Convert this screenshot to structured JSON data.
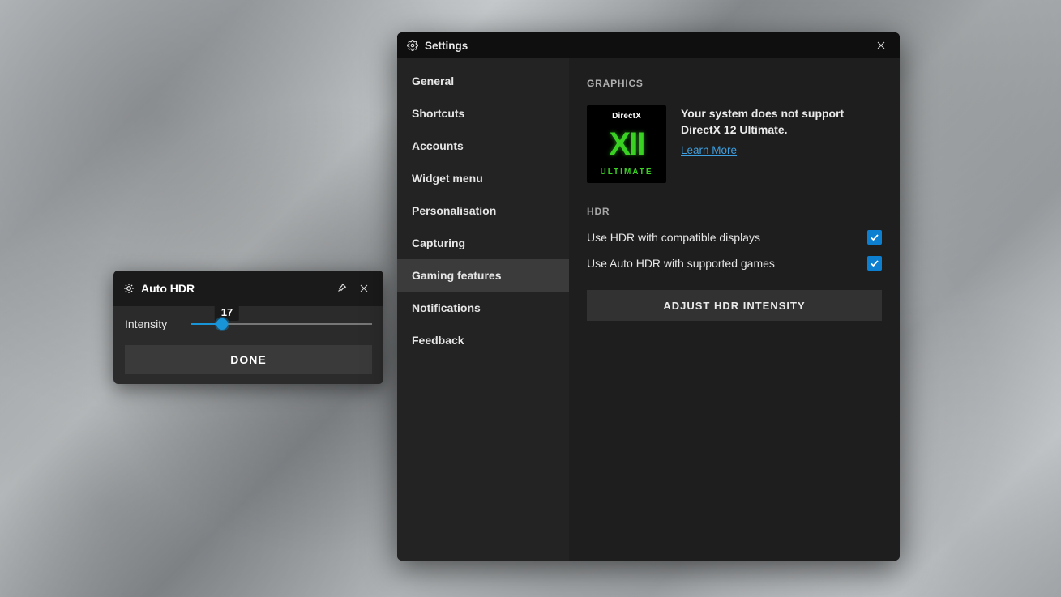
{
  "hdr_panel": {
    "title": "Auto HDR",
    "intensity_label": "Intensity",
    "intensity_value": "17",
    "intensity_percent": 17,
    "done_label": "DONE"
  },
  "settings": {
    "window_title": "Settings",
    "sidebar": {
      "items": [
        {
          "label": "General",
          "selected": false
        },
        {
          "label": "Shortcuts",
          "selected": false
        },
        {
          "label": "Accounts",
          "selected": false
        },
        {
          "label": "Widget menu",
          "selected": false
        },
        {
          "label": "Personalisation",
          "selected": false
        },
        {
          "label": "Capturing",
          "selected": false
        },
        {
          "label": "Gaming features",
          "selected": true
        },
        {
          "label": "Notifications",
          "selected": false
        },
        {
          "label": "Feedback",
          "selected": false
        }
      ]
    },
    "content": {
      "graphics": {
        "heading": "GRAPHICS",
        "badge": {
          "top": "DirectX",
          "mid": "XII",
          "bottom": "ULTIMATE"
        },
        "message": "Your system does not support DirectX 12 Ultimate.",
        "link_label": "Learn More"
      },
      "hdr": {
        "heading": "HDR",
        "options": [
          {
            "label": "Use HDR with compatible displays",
            "checked": true
          },
          {
            "label": "Use Auto HDR with supported games",
            "checked": true
          }
        ],
        "adjust_label": "ADJUST HDR INTENSITY"
      }
    }
  }
}
